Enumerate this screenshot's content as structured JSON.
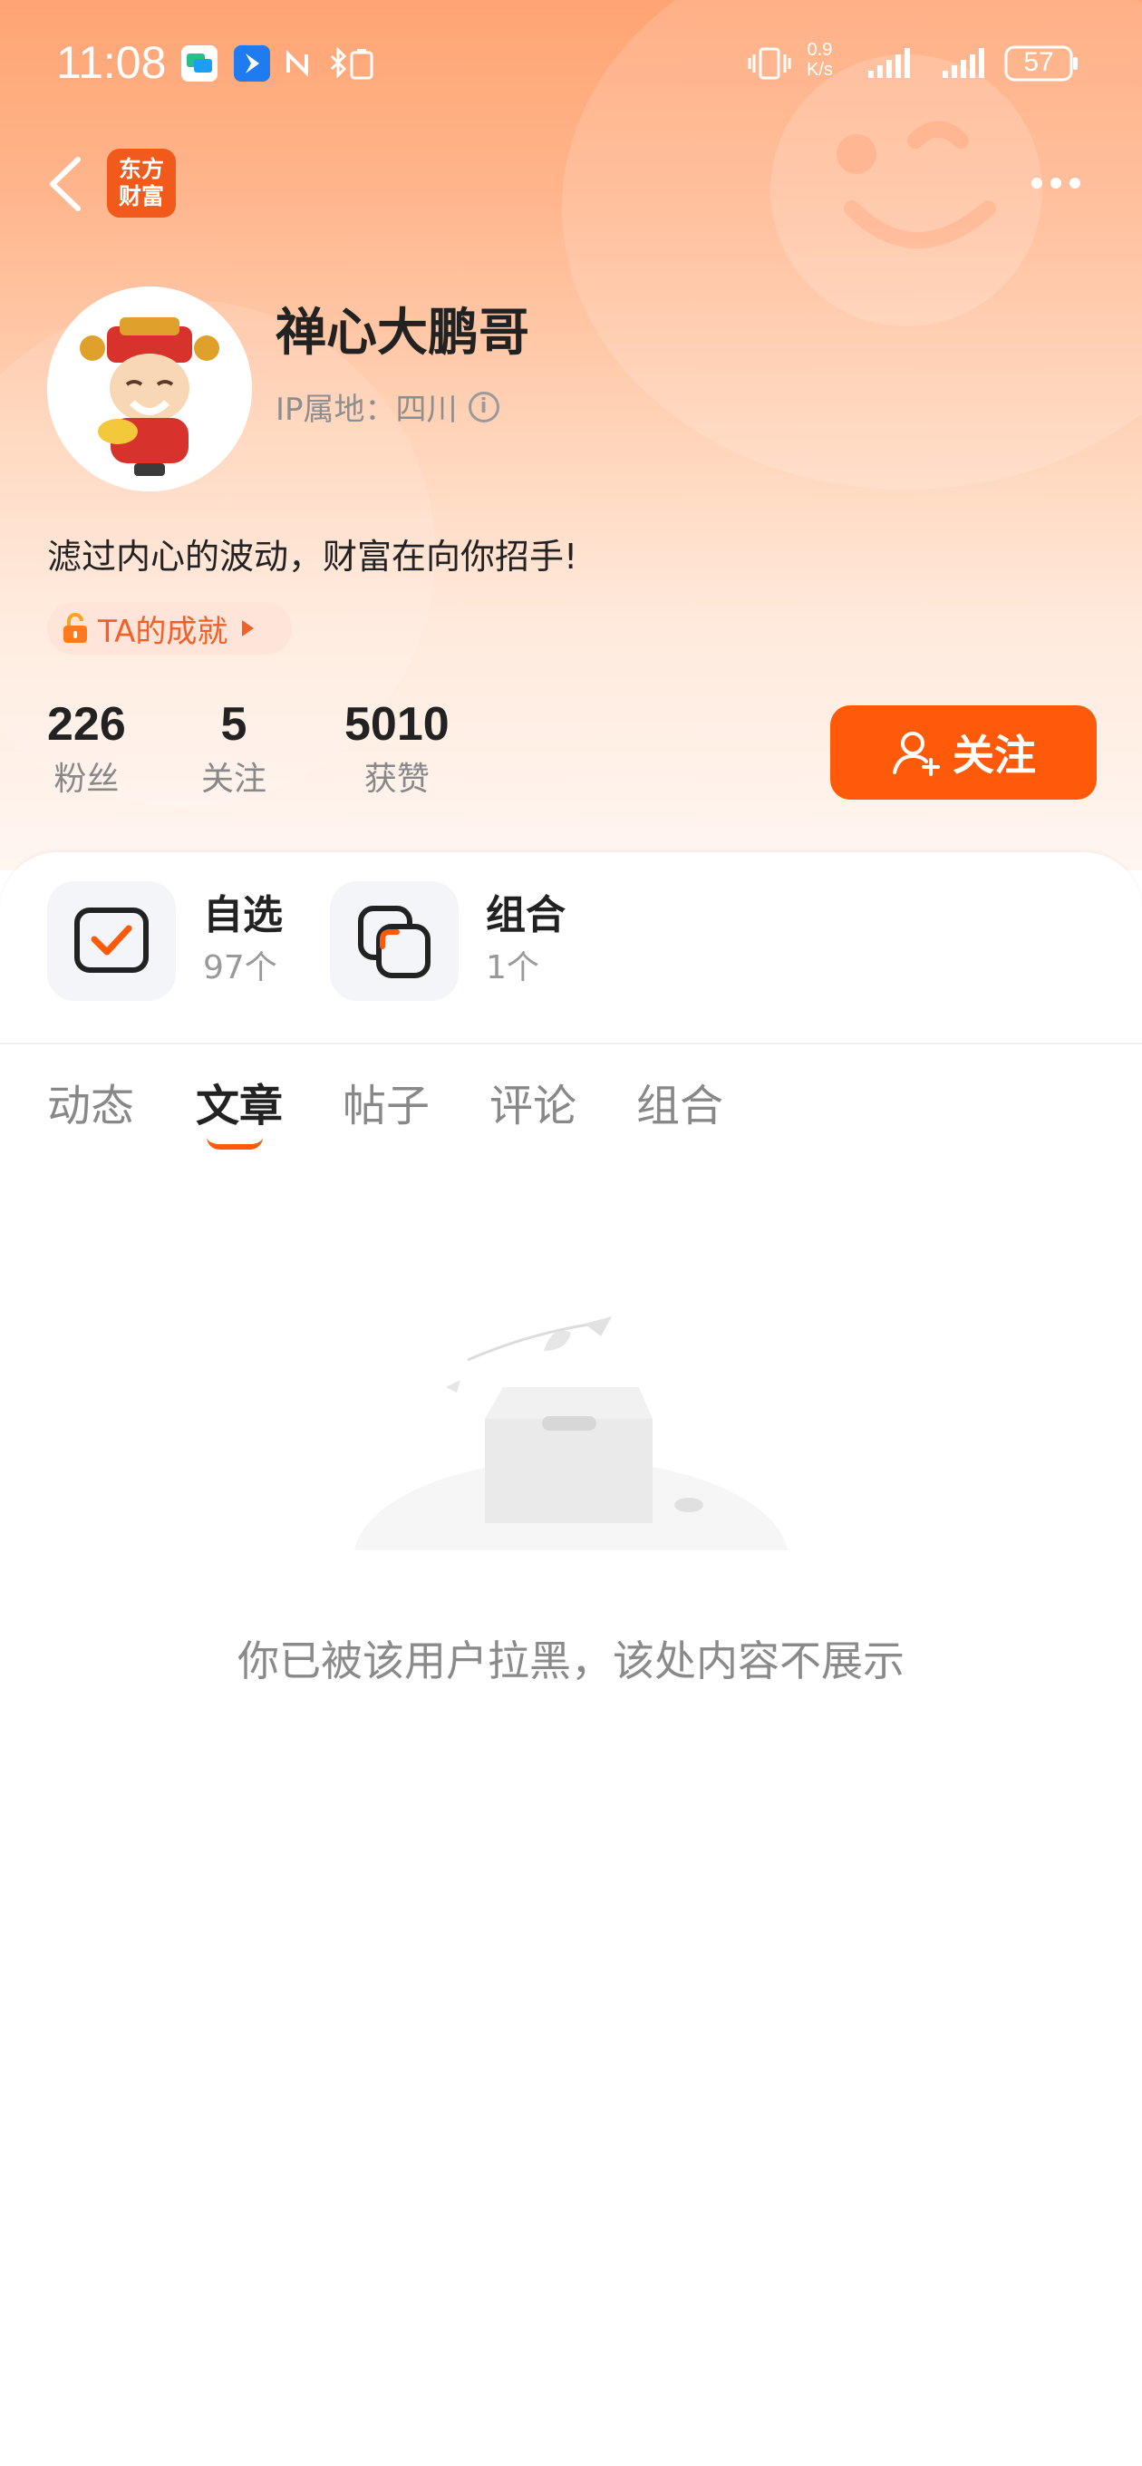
{
  "status_bar": {
    "time": "11:08",
    "net_speed_value": "0.9",
    "net_speed_unit": "K/s",
    "battery": "57"
  },
  "nav": {
    "logo_line1": "东方",
    "logo_line2": "财富"
  },
  "profile": {
    "name": "禅心大鹏哥",
    "ip_location": "IP属地：四川",
    "bio": "滤过内心的波动，财富在向你招手!",
    "achievement": "TA的成就"
  },
  "stats": [
    {
      "value": "226",
      "label": "粉丝"
    },
    {
      "value": "5",
      "label": "关注"
    },
    {
      "value": "5010",
      "label": "获赞"
    }
  ],
  "follow_button": "关注",
  "quick_links": [
    {
      "title": "自选",
      "count": "97个"
    },
    {
      "title": "组合",
      "count": "1个"
    }
  ],
  "tabs": [
    "动态",
    "文章",
    "帖子",
    "评论",
    "组合"
  ],
  "active_tab": "文章",
  "empty_message": "你已被该用户拉黑，该处内容不展示",
  "colors": {
    "accent": "#ff5a0a",
    "header_top": "#ffa473"
  }
}
